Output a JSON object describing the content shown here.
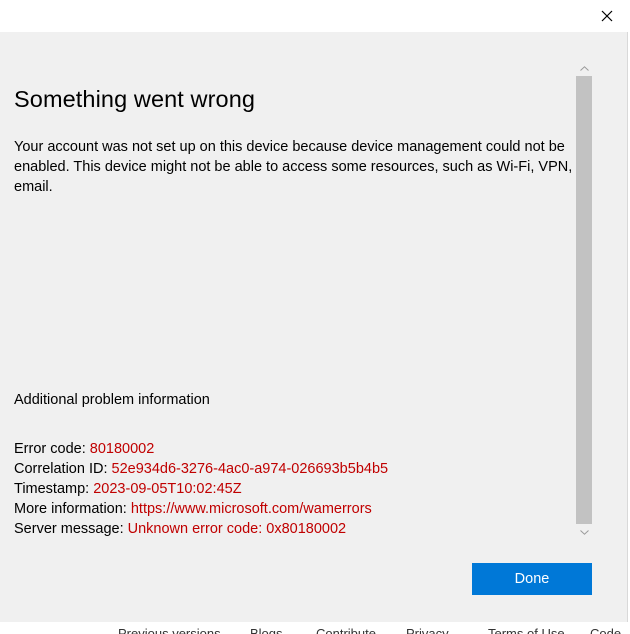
{
  "dialog": {
    "title": "Something went wrong",
    "message": "Your account was not set up on this device because device management could not be enabled. This device might not be able to access some resources, such as Wi-Fi, VPN, or email.",
    "additional_label": "Additional problem information",
    "details": {
      "error_code_label": "Error code: ",
      "error_code_value": "80180002",
      "correlation_label": "Correlation ID: ",
      "correlation_value": "52e934d6-3276-4ac0-a974-026693b5b4b5",
      "timestamp_label": "Timestamp: ",
      "timestamp_value": "2023-09-05T10:02:45Z",
      "more_info_label": "More information: ",
      "more_info_value": "https://www.microsoft.com/wamerrors",
      "server_msg_label": "Server message: ",
      "server_msg_value": "Unknown error code: 0x80180002"
    },
    "done_label": "Done"
  },
  "background_page": {
    "links": [
      "Previous versions",
      "Blogs",
      "Contribute",
      "Privacy",
      "Terms of Use",
      "Code"
    ]
  },
  "colors": {
    "accent": "#0078d7",
    "error_text": "#c00000",
    "content_bg": "#f0f0f0",
    "scroll_thumb": "#c2c2c2"
  },
  "icons": {
    "close": "close-icon",
    "scroll_up": "chevron-up-icon",
    "scroll_down": "chevron-down-icon"
  }
}
